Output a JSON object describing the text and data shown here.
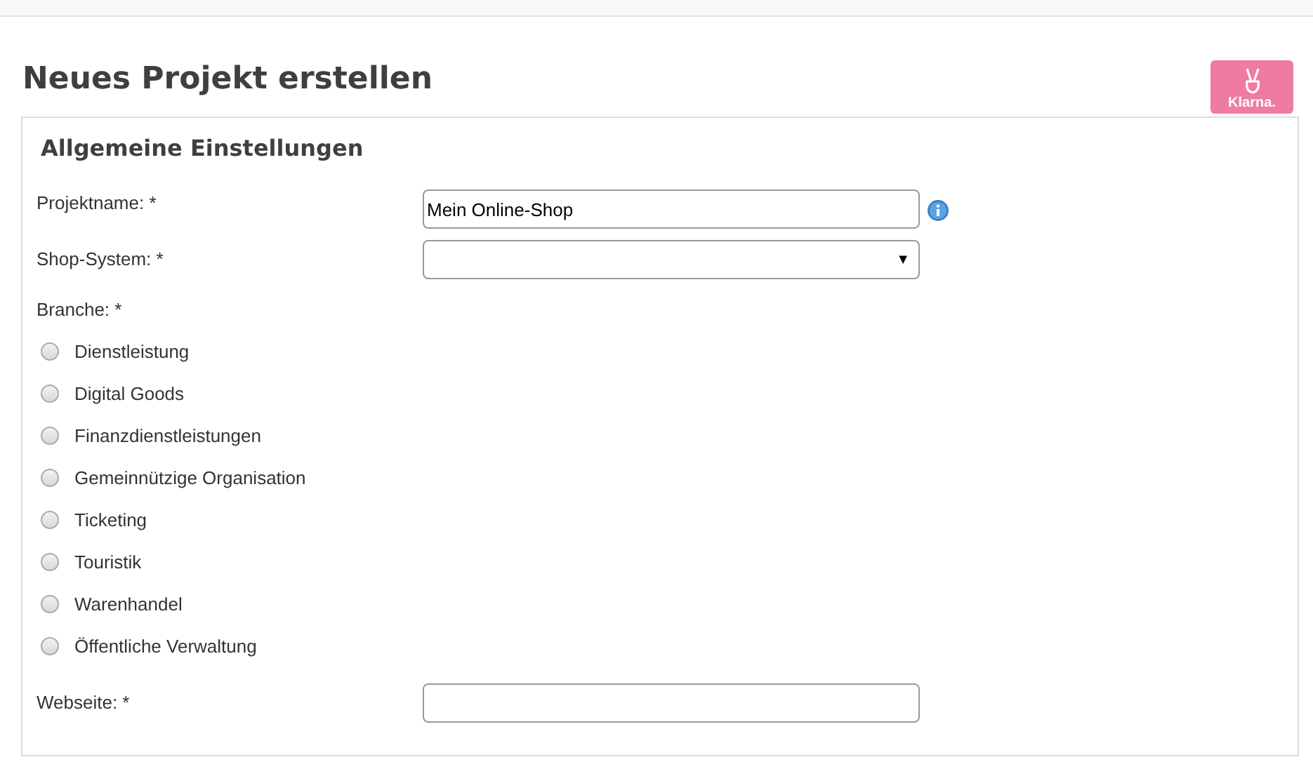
{
  "title": "Neues Projekt erstellen",
  "logo": {
    "text": "Klarna."
  },
  "panel": {
    "heading": "Allgemeine Einstellungen",
    "project_name": {
      "label": "Projektname: *",
      "value": "Mein Online-Shop"
    },
    "shop_system": {
      "label": "Shop-System: *",
      "arrow": "▼"
    },
    "branche": {
      "label": "Branche: *",
      "options": [
        {
          "label": "Dienstleistung",
          "selected": false
        },
        {
          "label": "Digital Goods",
          "selected": false
        },
        {
          "label": "Finanzdienstleistungen",
          "selected": false
        },
        {
          "label": "Gemeinnützige Organisation",
          "selected": false
        },
        {
          "label": "Ticketing",
          "selected": false
        },
        {
          "label": "Touristik",
          "selected": false
        },
        {
          "label": "Warenhandel",
          "selected": false
        },
        {
          "label": "Öffentliche Verwaltung",
          "selected": false
        }
      ]
    },
    "website": {
      "label": "Webseite: *"
    }
  }
}
